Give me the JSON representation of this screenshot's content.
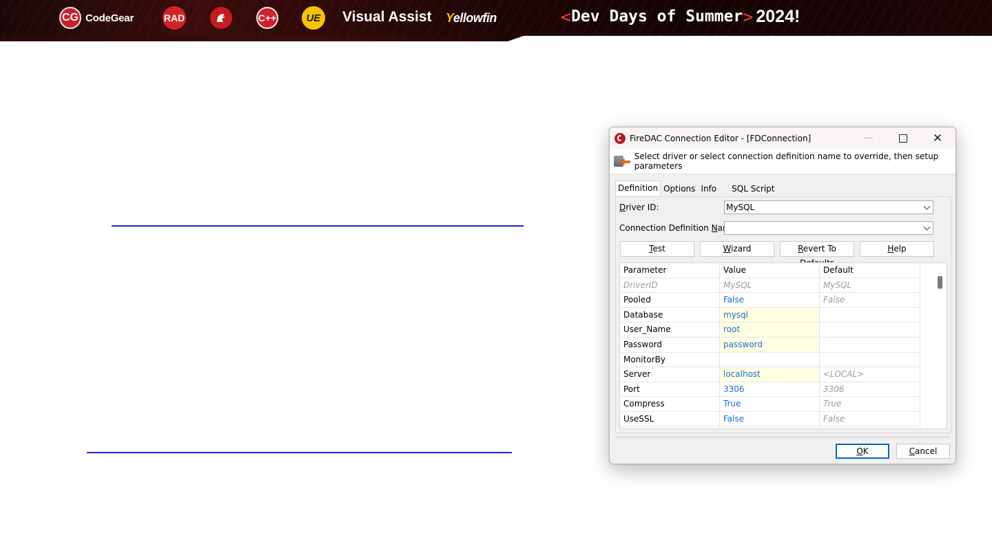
{
  "banner": {
    "logos": {
      "codegear_badge": "CG",
      "codegear": "CodeGear",
      "rad": "RAD",
      "cpp": "C++",
      "ue": "UE",
      "visual_assist": "Visual Assist",
      "yellowfin_y": "Y",
      "yellowfin_rest": "ellowfin"
    },
    "event": {
      "open_bracket": "<",
      "title": "Dev Days of Summer",
      "close_bracket": ">",
      "year": "2024!"
    }
  },
  "dialog": {
    "title": "FireDAC Connection Editor - [FDConnection]",
    "window_buttons": {
      "minimize": "—",
      "close": "✕"
    },
    "header_text": "Select driver or select connection definition name to override, then setup parameters",
    "tabs": [
      "Definition",
      "Options",
      "Info",
      "SQL Script"
    ],
    "driver_id": {
      "label_u": "D",
      "label_rest": "river ID:",
      "value": "MySQL"
    },
    "connection_definition": {
      "label_pre": "Connection Definition ",
      "label_u": "N",
      "label_rest": "ame:",
      "value": ""
    },
    "buttons": {
      "test": {
        "u": "T",
        "rest": "est"
      },
      "wizard": {
        "u": "W",
        "rest": "izard"
      },
      "revert": {
        "u": "R",
        "rest": "evert To Defaults"
      },
      "help": {
        "u": "H",
        "rest": "elp"
      }
    },
    "grid": {
      "columns": [
        "Parameter",
        "Value",
        "Default"
      ],
      "rows": [
        {
          "parameter": "DriverID",
          "value": "MySQL",
          "default": "MySQL"
        },
        {
          "parameter": "Pooled",
          "value": "False",
          "default": "False"
        },
        {
          "parameter": "Database",
          "value": "mysql",
          "default": ""
        },
        {
          "parameter": "User_Name",
          "value": "root",
          "default": ""
        },
        {
          "parameter": "Password",
          "value": "password",
          "default": ""
        },
        {
          "parameter": "MonitorBy",
          "value": "",
          "default": ""
        },
        {
          "parameter": "Server",
          "value": "localhost",
          "default": "<LOCAL>"
        },
        {
          "parameter": "Port",
          "value": "3306",
          "default": "3306"
        },
        {
          "parameter": "Compress",
          "value": "True",
          "default": "True"
        },
        {
          "parameter": "UseSSL",
          "value": "False",
          "default": "False"
        }
      ]
    },
    "footer": {
      "ok": {
        "u": "O",
        "rest": "K"
      },
      "cancel": {
        "u": "C",
        "rest": "ancel"
      }
    }
  },
  "colors": {
    "slide_line": "#1f24d6",
    "value_blue": "#1a6fd0",
    "edited_highlight": "#ffffe1",
    "ok_border": "#0b63c9"
  }
}
